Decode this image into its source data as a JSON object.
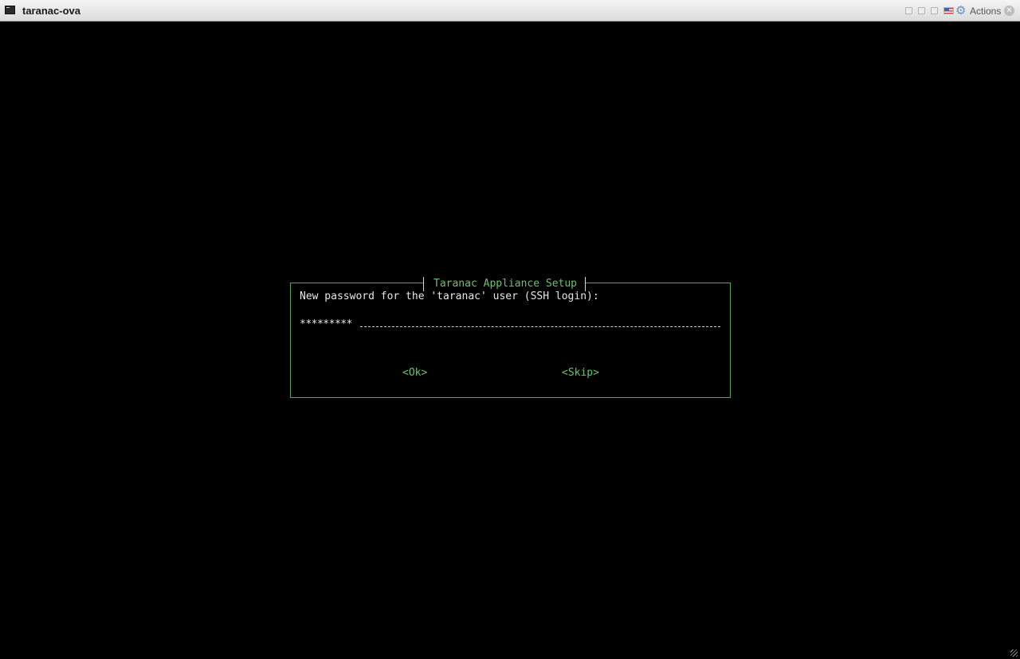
{
  "window": {
    "title": "taranac-ova",
    "actions_label": "Actions"
  },
  "toolbar_icons": [
    "snapshot-icon",
    "screenshot-icon",
    "fullscreen-icon",
    "keyboard-flag-icon",
    "gear-icon",
    "close-icon"
  ],
  "dialog": {
    "title": "Taranac Appliance Setup",
    "prompt": "New password for the 'taranac' user (SSH login):",
    "password_masked": "*********",
    "ok_label": "<Ok>",
    "skip_label": "<Skip>"
  },
  "colors": {
    "terminal_bg": "#000000",
    "accent_green": "#6fbf6f",
    "text": "#e6e6e6"
  }
}
